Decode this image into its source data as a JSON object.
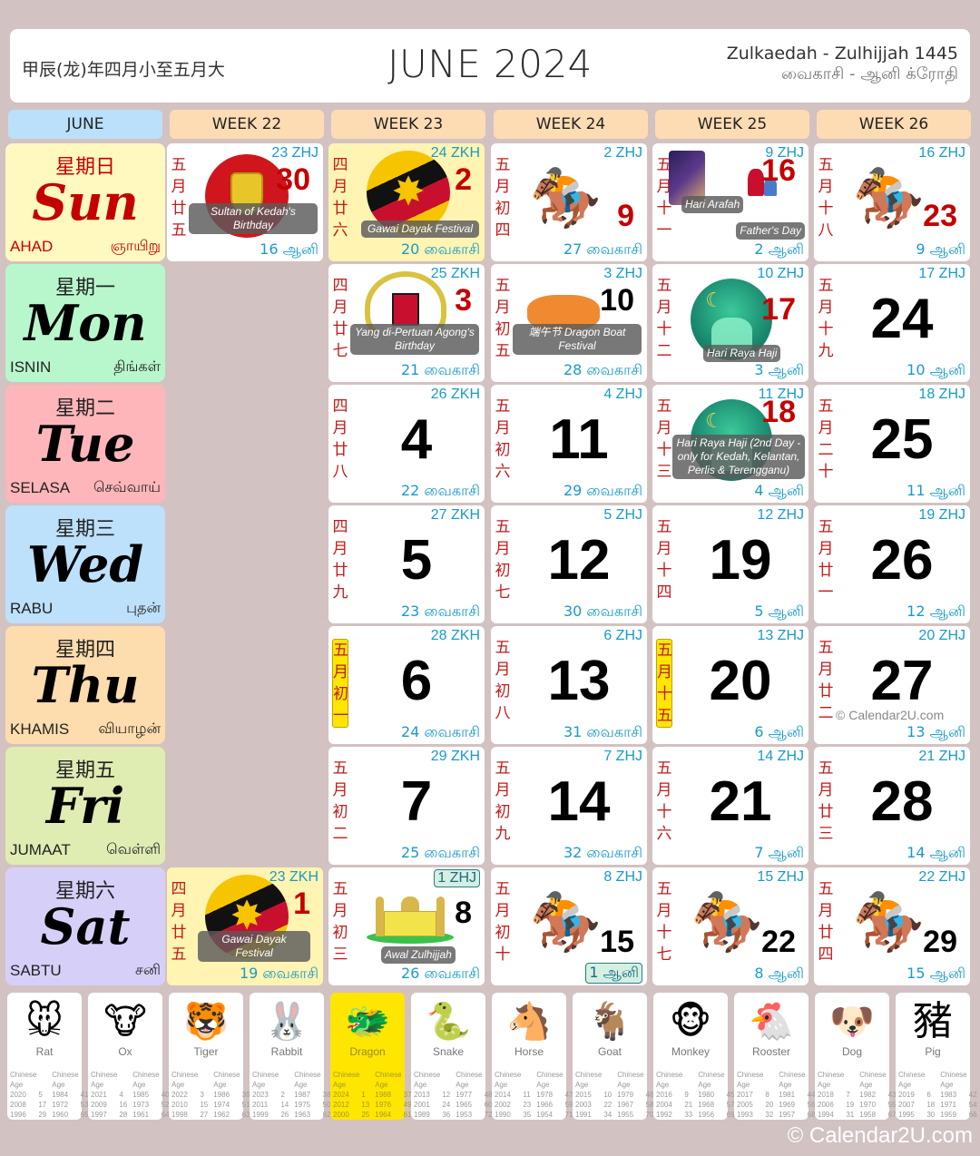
{
  "header": {
    "chinese_year": "甲辰(龙)年四月小至五月大",
    "title": "JUNE 2024",
    "hijri_range": "Zulkaedah - Zulhijjah 1445",
    "tamil_range": "வைகாசி - ஆனி  க்ரோதி"
  },
  "column_headers": [
    "JUNE",
    "WEEK 22",
    "WEEK 23",
    "WEEK 24",
    "WEEK 25",
    "WEEK 26"
  ],
  "days": [
    {
      "cn": "星期日",
      "en": "Sun",
      "my": "AHAD",
      "ta": "ஞாயிறு",
      "bg": "#fff9bf",
      "color": "#c40000"
    },
    {
      "cn": "星期一",
      "en": "Mon",
      "my": "ISNIN",
      "ta": "திங்கள்",
      "bg": "#b8f7cc",
      "color": "#000000"
    },
    {
      "cn": "星期二",
      "en": "Tue",
      "my": "SELASA",
      "ta": "செவ்வாய்",
      "bg": "#ffb6ba",
      "color": "#000000"
    },
    {
      "cn": "星期三",
      "en": "Wed",
      "my": "RABU",
      "ta": "புதன்",
      "bg": "#bde0fb",
      "color": "#000000"
    },
    {
      "cn": "星期四",
      "en": "Thu",
      "my": "KHAMIS",
      "ta": "வியாழன்",
      "bg": "#fddcad",
      "color": "#000000"
    },
    {
      "cn": "星期五",
      "en": "Fri",
      "my": "JUMAAT",
      "ta": "வெள்ளி",
      "bg": "#dfecb2",
      "color": "#000000"
    },
    {
      "cn": "星期六",
      "en": "Sat",
      "my": "SABTU",
      "ta": "சனி",
      "bg": "#d6d0f8",
      "color": "#000000"
    }
  ],
  "cells": [
    {
      "col": 1,
      "row": 0,
      "day": "30",
      "lunar": "五月廿五",
      "hijri": "23 ZHJ",
      "tamil": "16 ஆனி",
      "holiday": true,
      "event": "Sultan of Kedah's Birthday",
      "pic": "kedah-flag"
    },
    {
      "col": 2,
      "row": 0,
      "day": "2",
      "lunar": "四月廿六",
      "hijri": "24 ZKH",
      "tamil": "20 வைகாசி",
      "holiday": true,
      "yellow": true,
      "event": "Gawai Dayak Festival",
      "pic": "sarawak-flag"
    },
    {
      "col": 3,
      "row": 0,
      "day": "9",
      "lunar": "五月初四",
      "hijri": "2 ZHJ",
      "tamil": "27 வைகாசி",
      "holiday": true,
      "pic": "horse-racing"
    },
    {
      "col": 4,
      "row": 0,
      "day": "16",
      "lunar": "五月十一",
      "hijri": "9 ZHJ",
      "tamil": "2 ஆனி",
      "holiday": true,
      "event": "Hari Arafah",
      "event2": "Father's Day",
      "pic": "arafah-fathers-day"
    },
    {
      "col": 5,
      "row": 0,
      "day": "23",
      "lunar": "五月十八",
      "hijri": "16 ZHJ",
      "tamil": "9 ஆனி",
      "holiday": true,
      "pic": "horse-racing"
    },
    {
      "col": 2,
      "row": 1,
      "day": "3",
      "lunar": "四月廿七",
      "hijri": "25 ZKH",
      "tamil": "21 வைகாசி",
      "holiday": true,
      "event": "Yang di-Pertuan Agong's Birthday",
      "pic": "coat-of-arms"
    },
    {
      "col": 3,
      "row": 1,
      "day": "10",
      "lunar": "五月初五",
      "hijri": "3 ZHJ",
      "tamil": "28 வைகாசி",
      "event": "端午节 Dragon Boat Festival",
      "pic": "dragon-boat"
    },
    {
      "col": 4,
      "row": 1,
      "day": "17",
      "lunar": "五月十二",
      "hijri": "10 ZHJ",
      "tamil": "3 ஆனி",
      "holiday": true,
      "event": "Hari Raya Haji",
      "pic": "mosque-night"
    },
    {
      "col": 5,
      "row": 1,
      "day": "24",
      "lunar": "五月十九",
      "hijri": "17 ZHJ",
      "tamil": "10 ஆனி"
    },
    {
      "col": 2,
      "row": 2,
      "day": "4",
      "lunar": "四月廿八",
      "hijri": "26 ZKH",
      "tamil": "22 வைகாசி"
    },
    {
      "col": 3,
      "row": 2,
      "day": "11",
      "lunar": "五月初六",
      "hijri": "4 ZHJ",
      "tamil": "29 வைகாசி"
    },
    {
      "col": 4,
      "row": 2,
      "day": "18",
      "lunar": "五月十三",
      "hijri": "11 ZHJ",
      "tamil": "4 ஆனி",
      "holiday": true,
      "event": "Hari Raya Haji (2nd Day - only for Kedah, Kelantan, Perlis & Terengganu)",
      "pic": "mosque-night"
    },
    {
      "col": 5,
      "row": 2,
      "day": "25",
      "lunar": "五月二十",
      "hijri": "18 ZHJ",
      "tamil": "11 ஆனி"
    },
    {
      "col": 2,
      "row": 3,
      "day": "5",
      "lunar": "四月廿九",
      "hijri": "27 ZKH",
      "tamil": "23 வைகாசி"
    },
    {
      "col": 3,
      "row": 3,
      "day": "12",
      "lunar": "五月初七",
      "hijri": "5 ZHJ",
      "tamil": "30 வைகாசி"
    },
    {
      "col": 4,
      "row": 3,
      "day": "19",
      "lunar": "五月十四",
      "hijri": "12 ZHJ",
      "tamil": "5 ஆனி"
    },
    {
      "col": 5,
      "row": 3,
      "day": "26",
      "lunar": "五月廿一",
      "hijri": "19 ZHJ",
      "tamil": "12 ஆனி"
    },
    {
      "col": 2,
      "row": 4,
      "day": "6",
      "lunar": "五月初一",
      "lunar_highlight": true,
      "hijri": "28 ZKH",
      "tamil": "24 வைகாசி"
    },
    {
      "col": 3,
      "row": 4,
      "day": "13",
      "lunar": "五月初八",
      "hijri": "6 ZHJ",
      "tamil": "31 வைகாசி"
    },
    {
      "col": 4,
      "row": 4,
      "day": "20",
      "lunar": "五月十五",
      "lunar_highlight": true,
      "hijri": "13 ZHJ",
      "tamil": "6 ஆனி"
    },
    {
      "col": 5,
      "row": 4,
      "day": "27",
      "lunar": "五月廿二",
      "hijri": "20 ZHJ",
      "tamil": "13 ஆனி"
    },
    {
      "col": 2,
      "row": 5,
      "day": "7",
      "lunar": "五月初二",
      "hijri": "29 ZKH",
      "tamil": "25 வைகாசி"
    },
    {
      "col": 3,
      "row": 5,
      "day": "14",
      "lunar": "五月初九",
      "hijri": "7 ZHJ",
      "tamil": "32 வைகாசி"
    },
    {
      "col": 4,
      "row": 5,
      "day": "21",
      "lunar": "五月十六",
      "hijri": "14 ZHJ",
      "tamil": "7 ஆனி"
    },
    {
      "col": 5,
      "row": 5,
      "day": "28",
      "lunar": "五月廿三",
      "hijri": "21 ZHJ",
      "tamil": "14 ஆனி"
    },
    {
      "col": 1,
      "row": 6,
      "day": "1",
      "lunar": "四月廿五",
      "hijri": "23 ZKH",
      "tamil": "19 வைகாசி",
      "holiday": true,
      "yellow": true,
      "event": "Gawai Dayak Festival",
      "pic": "sarawak-flag"
    },
    {
      "col": 2,
      "row": 6,
      "day": "8",
      "lunar": "五月初三",
      "hijri": "1 ZHJ",
      "hijri_boxed": true,
      "tamil": "26 வைகாசி",
      "event": "Awal Zulhijjah",
      "pic": "mosque-yellow"
    },
    {
      "col": 3,
      "row": 6,
      "day": "15",
      "lunar": "五月初十",
      "hijri": "8 ZHJ",
      "tamil": "1 ஆனி",
      "tamil_boxed": true,
      "pic": "horse-racing"
    },
    {
      "col": 4,
      "row": 6,
      "day": "22",
      "lunar": "五月十七",
      "hijri": "15 ZHJ",
      "tamil": "8 ஆனி",
      "pic": "horse-racing"
    },
    {
      "col": 5,
      "row": 6,
      "day": "29",
      "lunar": "五月廿四",
      "hijri": "22 ZHJ",
      "tamil": "15 ஆனி",
      "pic": "horse-racing"
    }
  ],
  "watermark_small": "© Calendar2U.com",
  "zodiac_header": [
    "Chinese",
    "Age",
    "Chinese",
    "Age"
  ],
  "zodiac": [
    {
      "name": "Rat",
      "icon": "🐭",
      "rows": [
        [
          "2020",
          "5",
          "1984",
          "41"
        ],
        [
          "2008",
          "17",
          "1972",
          "53"
        ],
        [
          "1996",
          "29",
          "1960",
          "65"
        ]
      ]
    },
    {
      "name": "Ox",
      "icon": "🐮",
      "rows": [
        [
          "2021",
          "4",
          "1985",
          "40"
        ],
        [
          "2009",
          "16",
          "1973",
          "52"
        ],
        [
          "1997",
          "28",
          "1961",
          "64"
        ]
      ]
    },
    {
      "name": "Tiger",
      "icon": "🐯",
      "rows": [
        [
          "2022",
          "3",
          "1986",
          "39"
        ],
        [
          "2010",
          "15",
          "1974",
          "51"
        ],
        [
          "1998",
          "27",
          "1962",
          "63"
        ]
      ]
    },
    {
      "name": "Rabbit",
      "icon": "🐰",
      "rows": [
        [
          "2023",
          "2",
          "1987",
          "38"
        ],
        [
          "2011",
          "14",
          "1975",
          "50"
        ],
        [
          "1999",
          "26",
          "1963",
          "62"
        ]
      ]
    },
    {
      "name": "Dragon",
      "icon": "🐲",
      "active": true,
      "rows": [
        [
          "2024",
          "1",
          "1988",
          "37"
        ],
        [
          "2012",
          "13",
          "1976",
          "49"
        ],
        [
          "2000",
          "25",
          "1964",
          "61"
        ]
      ]
    },
    {
      "name": "Snake",
      "icon": "🐍",
      "rows": [
        [
          "2013",
          "12",
          "1977",
          "48"
        ],
        [
          "2001",
          "24",
          "1965",
          "60"
        ],
        [
          "1989",
          "36",
          "1953",
          "72"
        ]
      ]
    },
    {
      "name": "Horse",
      "icon": "🐴",
      "rows": [
        [
          "2014",
          "11",
          "1978",
          "47"
        ],
        [
          "2002",
          "23",
          "1966",
          "59"
        ],
        [
          "1990",
          "35",
          "1954",
          "71"
        ]
      ]
    },
    {
      "name": "Goat",
      "icon": "🐐",
      "rows": [
        [
          "2015",
          "10",
          "1979",
          "46"
        ],
        [
          "2003",
          "22",
          "1967",
          "58"
        ],
        [
          "1991",
          "34",
          "1955",
          "70"
        ]
      ]
    },
    {
      "name": "Monkey",
      "icon": "🐵",
      "rows": [
        [
          "2016",
          "9",
          "1980",
          "45"
        ],
        [
          "2004",
          "21",
          "1968",
          "57"
        ],
        [
          "1992",
          "33",
          "1956",
          "69"
        ]
      ]
    },
    {
      "name": "Rooster",
      "icon": "🐔",
      "rows": [
        [
          "2017",
          "8",
          "1981",
          "44"
        ],
        [
          "2005",
          "20",
          "1969",
          "56"
        ],
        [
          "1993",
          "32",
          "1957",
          "68"
        ]
      ]
    },
    {
      "name": "Dog",
      "icon": "🐶",
      "rows": [
        [
          "2018",
          "7",
          "1982",
          "43"
        ],
        [
          "2006",
          "19",
          "1970",
          "55"
        ],
        [
          "1994",
          "31",
          "1958",
          "67"
        ]
      ]
    },
    {
      "name": "Pig",
      "icon": "豬",
      "icon_is_char": true,
      "rows": [
        [
          "2019",
          "6",
          "1983",
          "42"
        ],
        [
          "2007",
          "18",
          "1971",
          "54"
        ],
        [
          "1995",
          "30",
          "1959",
          "66"
        ]
      ]
    }
  ],
  "footer_watermark": "© Calendar2U.com",
  "colors": {
    "holiday_red": "#c40000",
    "lunar_red": "#c21a1a",
    "hijri_blue": "#1a9ac7",
    "lunar_highlight": "#ffe600",
    "background": "#d3c2c2"
  }
}
